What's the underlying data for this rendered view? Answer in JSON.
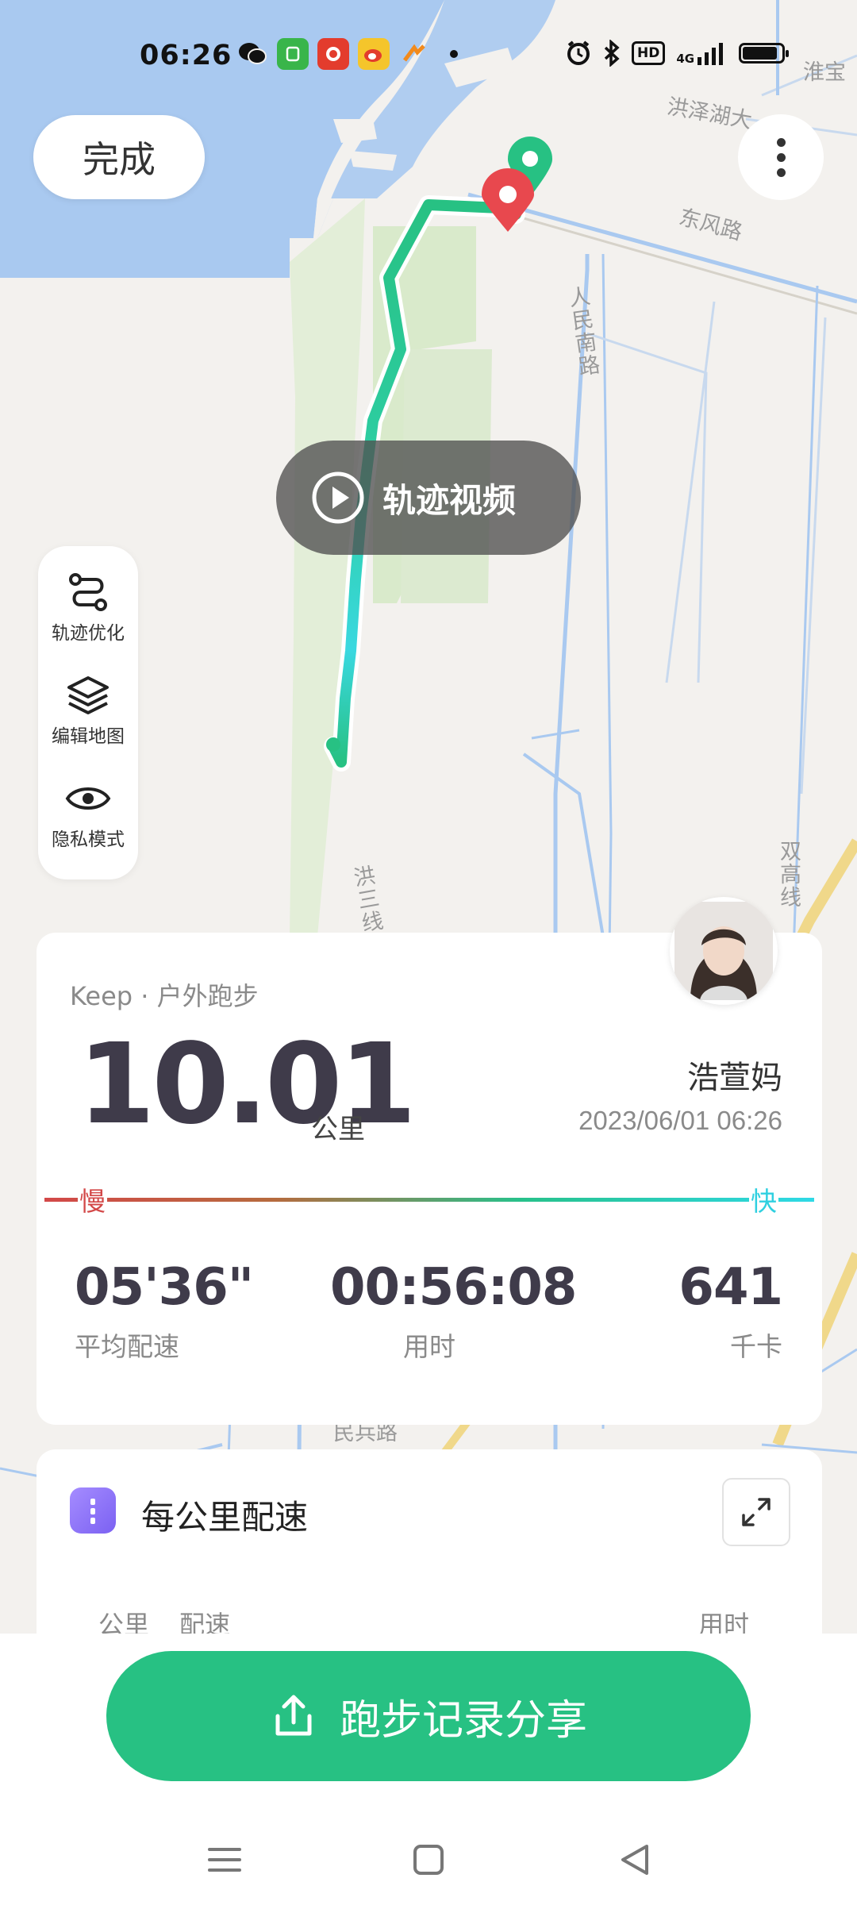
{
  "status_bar": {
    "time": "06:26",
    "app_icons": [
      "wechat-icon",
      "app-green-icon",
      "app-red-icon",
      "weibo-icon",
      "app-orange-icon"
    ],
    "hd_label": "HD",
    "network_label": "4G",
    "icons": [
      "alarm-icon",
      "bluetooth-icon",
      "signal-icon",
      "battery-icon"
    ],
    "battery_level": 0.9
  },
  "header": {
    "done_label": "完成"
  },
  "map": {
    "labels": {
      "huaibao": "淮宝",
      "hongzehu": "洪泽湖大",
      "dongfeng": "东风路",
      "renmin": "人民南路",
      "hongsan": "洪三线",
      "shuanggao": "双高线",
      "minbing": "民兵路"
    },
    "video_label": "轨迹视频"
  },
  "tools": [
    {
      "label": "轨迹优化",
      "icon": "route-icon"
    },
    {
      "label": "编辑地图",
      "icon": "layers-icon"
    },
    {
      "label": "隐私模式",
      "icon": "eye-icon"
    }
  ],
  "summary": {
    "source": "Keep · 户外跑步",
    "distance": "10.01",
    "distance_unit": "公里",
    "user_name": "浩萱妈",
    "datetime": "2023/06/01 06:26",
    "slow_label": "慢",
    "fast_label": "快",
    "stats": [
      {
        "value": "05'36\"",
        "label": "平均配速"
      },
      {
        "value": "00:56:08",
        "label": "用时"
      },
      {
        "value": "641",
        "label": "千卡"
      }
    ]
  },
  "km_pace": {
    "title": "每公里配速",
    "columns": [
      "公里",
      "配速",
      "用时"
    ]
  },
  "share": {
    "label": "跑步记录分享"
  },
  "colors": {
    "accent": "#27c183",
    "water": "#a9c9f0",
    "park": "#d9eacb",
    "slow": "#d34848",
    "fast": "#2fd9e6"
  }
}
